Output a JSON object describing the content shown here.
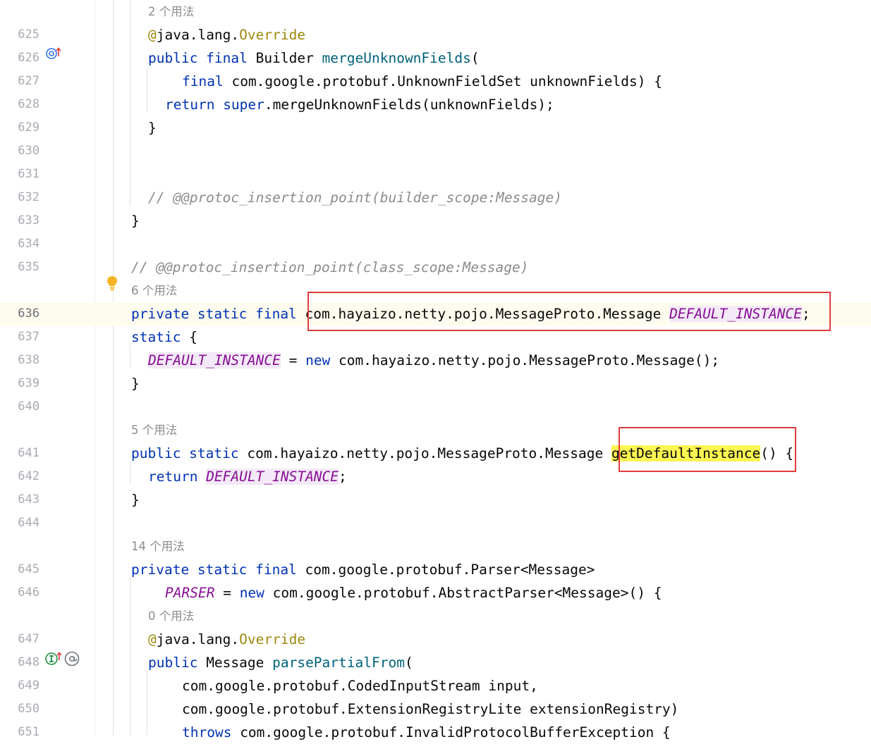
{
  "lines": [
    {
      "hint": "2 个用法"
    },
    {
      "num": "625",
      "tokens": [
        {
          "t": "@",
          "c": "ann"
        },
        {
          "t": "java.lang."
        },
        {
          "t": "Override",
          "c": "ann"
        }
      ]
    },
    {
      "num": "626",
      "tokens": [
        {
          "t": "public final ",
          "c": "kw"
        },
        {
          "t": "Builder "
        },
        {
          "t": "mergeUnknownFields",
          "c": "fn"
        },
        {
          "t": "("
        }
      ]
    },
    {
      "num": "627",
      "tokens": [
        {
          "t": "final ",
          "c": "kw"
        },
        {
          "t": "com.google.protobuf.UnknownFieldSet unknownFields) {"
        }
      ]
    },
    {
      "num": "628",
      "tokens": [
        {
          "t": "return ",
          "c": "kw"
        },
        {
          "t": "super",
          "c": "kw"
        },
        {
          "t": ".mergeUnknownFields(unknownFields);"
        }
      ]
    },
    {
      "num": "629",
      "tokens": [
        {
          "t": "}"
        }
      ]
    },
    {
      "num": "630",
      "tokens": []
    },
    {
      "num": "631",
      "tokens": []
    },
    {
      "num": "632",
      "tokens": [
        {
          "t": "// @@protoc_insertion_point(builder_scope:Message)",
          "c": "cm"
        }
      ]
    },
    {
      "num": "633",
      "tokens": [
        {
          "t": "}"
        }
      ]
    },
    {
      "num": "634",
      "tokens": []
    },
    {
      "num": "635",
      "tokens": [
        {
          "t": "// @@protoc_insertion_point(class_scope:Message)",
          "c": "cm"
        }
      ]
    },
    {
      "hint": "6 个用法"
    },
    {
      "num": "636",
      "tokens": [
        {
          "t": "private static final ",
          "c": "kw"
        },
        {
          "t": "com.hayaizo.netty.pojo.MessageProto.Message "
        },
        {
          "t": "DEFAULT_INSTANCE",
          "c": "const hl"
        },
        {
          "t": ";"
        }
      ]
    },
    {
      "num": "637",
      "tokens": [
        {
          "t": "static ",
          "c": "kw"
        },
        {
          "t": "{"
        }
      ]
    },
    {
      "num": "638",
      "tokens": [
        {
          "t": "DEFAULT_INSTANCE",
          "c": "const hl"
        },
        {
          "t": " = "
        },
        {
          "t": "new ",
          "c": "kw"
        },
        {
          "t": "com.hayaizo.netty.pojo.MessageProto.Message();"
        }
      ]
    },
    {
      "num": "639",
      "tokens": [
        {
          "t": "}"
        }
      ]
    },
    {
      "num": "640",
      "tokens": []
    },
    {
      "hint": "5 个用法"
    },
    {
      "num": "641",
      "tokens": [
        {
          "t": "public static ",
          "c": "kw"
        },
        {
          "t": "com.hayaizo.netty.pojo.MessageProto.Message "
        },
        {
          "t": "getDefaultInstance",
          "c": "hl-yellow"
        },
        {
          "t": "() {"
        }
      ]
    },
    {
      "num": "642",
      "tokens": [
        {
          "t": "return ",
          "c": "kw"
        },
        {
          "t": "DEFAULT_INSTANCE",
          "c": "const hl"
        },
        {
          "t": ";"
        }
      ]
    },
    {
      "num": "643",
      "tokens": [
        {
          "t": "}"
        }
      ]
    },
    {
      "num": "644",
      "tokens": []
    },
    {
      "hint": "14 个用法"
    },
    {
      "num": "645",
      "tokens": [
        {
          "t": "private static final ",
          "c": "kw"
        },
        {
          "t": "com.google.protobuf.Parser<Message>"
        }
      ]
    },
    {
      "num": "646",
      "tokens": [
        {
          "t": "PARSER",
          "c": "const"
        },
        {
          "t": " = "
        },
        {
          "t": "new ",
          "c": "kw"
        },
        {
          "t": "com.google.protobuf.AbstractParser<Message>() {"
        }
      ]
    },
    {
      "hint": "0 个用法"
    },
    {
      "num": "647",
      "tokens": [
        {
          "t": "@",
          "c": "ann"
        },
        {
          "t": "java.lang."
        },
        {
          "t": "Override",
          "c": "ann"
        }
      ]
    },
    {
      "num": "648",
      "tokens": [
        {
          "t": "public ",
          "c": "kw"
        },
        {
          "t": "Message "
        },
        {
          "t": "parsePartialFrom",
          "c": "fn"
        },
        {
          "t": "("
        }
      ]
    },
    {
      "num": "649",
      "tokens": [
        {
          "t": "com.google.protobuf.CodedInputStream input,"
        }
      ]
    },
    {
      "num": "650",
      "tokens": [
        {
          "t": "com.google.protobuf.ExtensionRegistryLite extensionRegistry)"
        }
      ]
    },
    {
      "num": "651",
      "tokens": [
        {
          "t": "throws ",
          "c": "kw"
        },
        {
          "t": "com.google.protobuf.InvalidProtocolBufferException {"
        }
      ]
    }
  ],
  "gutter_icons": {
    "line_626": "override-up-icon",
    "line_636": "lightbulb-icon",
    "line_648": "implements-up-icon",
    "line_648_b": "at-annotation-icon"
  },
  "highlight_boxes": [
    "declaration-box",
    "method-name-box"
  ],
  "colors": {
    "keyword": "#0033b3",
    "annotation": "#9e880d",
    "method": "#00627a",
    "comment": "#8c8c8c",
    "constant": "#871094",
    "highlight_box": "#e23c3c",
    "search_match": "#fdf552"
  }
}
